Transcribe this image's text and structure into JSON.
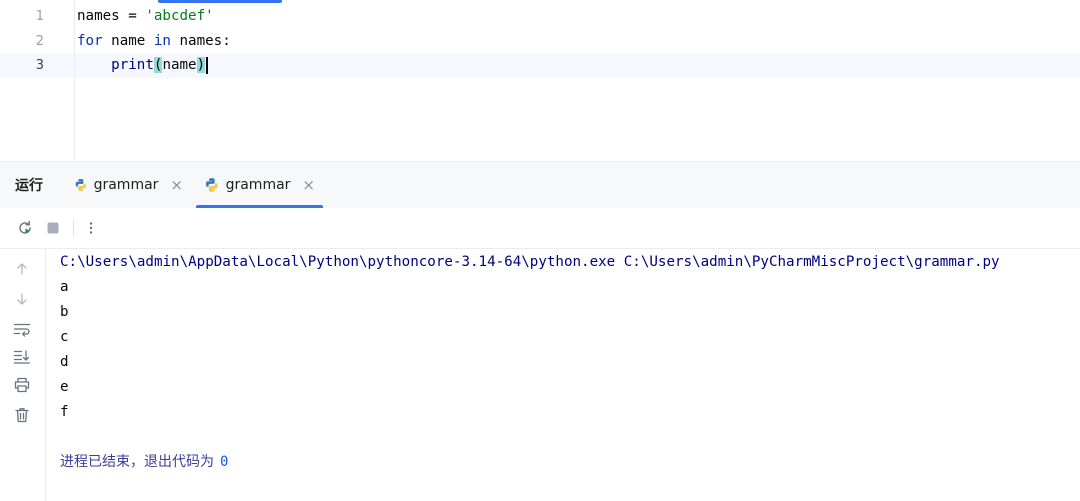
{
  "editor": {
    "line_numbers": [
      "1",
      "2",
      "3"
    ],
    "lines": [
      {
        "tokens": [
          {
            "t": "names = ",
            "c": ""
          },
          {
            "t": "'abcdef'",
            "c": "str"
          }
        ]
      },
      {
        "tokens": [
          {
            "t": "for",
            "c": "kw"
          },
          {
            "t": " name ",
            "c": ""
          },
          {
            "t": "in",
            "c": "kw"
          },
          {
            "t": " names:",
            "c": ""
          }
        ]
      },
      {
        "tokens": [
          {
            "t": "    ",
            "c": ""
          },
          {
            "t": "print",
            "c": "fn"
          },
          {
            "t": "(",
            "c": "brace-hl"
          },
          {
            "t": "name",
            "c": ""
          },
          {
            "t": ")",
            "c": "brace-hl"
          }
        ]
      }
    ]
  },
  "run_window": {
    "title": "运行",
    "tabs": [
      {
        "label": "grammar",
        "close": "×",
        "active": false
      },
      {
        "label": "grammar",
        "close": "×",
        "active": true
      }
    ],
    "toolbar": {
      "rerun_icon": "rerun-icon",
      "stop_icon": "stop-icon",
      "more_icon": "more-vertical-icon"
    },
    "side_icons": [
      "arrow-up-icon",
      "arrow-down-icon",
      "soft-wrap-icon",
      "scroll-to-end-icon",
      "print-icon",
      "trash-icon"
    ],
    "console": {
      "command": "C:\\Users\\admin\\AppData\\Local\\Python\\pythoncore-3.14-64\\python.exe C:\\Users\\admin\\PyCharmMiscProject\\grammar.py",
      "output": [
        "a",
        "b",
        "c",
        "d",
        "e",
        "f"
      ],
      "exit_message": "进程已结束，退出代码为",
      "exit_code": "0"
    }
  },
  "colors": {
    "accent": "#3574f0",
    "keyword": "#0033b3",
    "string": "#067d17",
    "builtin": "#000080",
    "brace_highlight": "#93d9d9"
  }
}
